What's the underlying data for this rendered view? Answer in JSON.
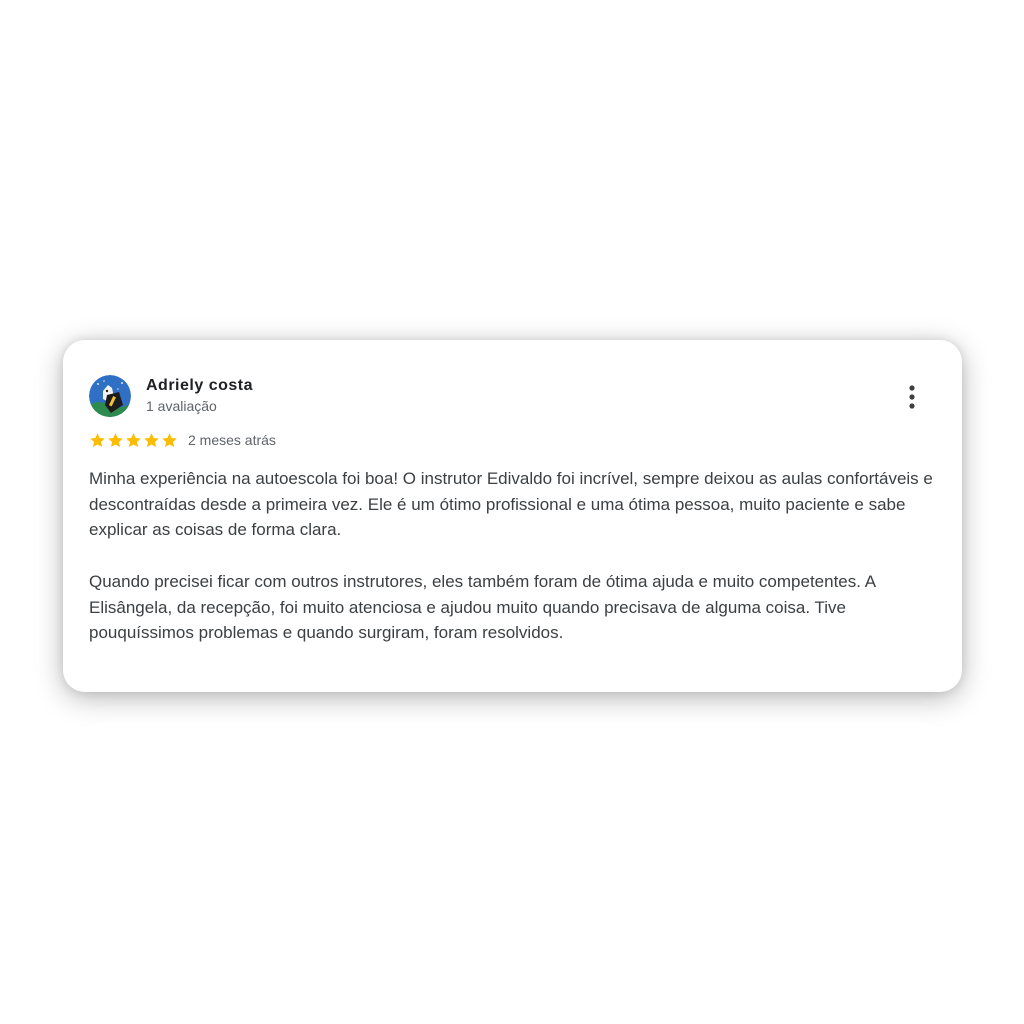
{
  "review": {
    "author_name": "Adriely costa",
    "author_review_count": "1 avaliação",
    "rating": 5,
    "rating_max": 5,
    "date": "2 meses atrás",
    "paragraphs": [
      "Minha experiência na autoescola foi boa! O instrutor Edivaldo foi incrível, sempre deixou as aulas confortáveis e descontraídas desde a primeira vez. Ele é um ótimo profissional e uma ótima pessoa, muito paciente e sabe explicar as coisas de forma clara.",
      "Quando precisei ficar com outros instrutores, eles também foram de ótima ajuda e muito competentes. A Elisângela, da recepção, foi muito atenciosa e ajudou muito quando precisava de alguma coisa. Tive pouquíssimos problemas e quando surgiram, foram resolvidos."
    ]
  },
  "icons": {
    "avatar": "avatar-image",
    "menu": "more-vert-icon",
    "star": "star-icon"
  },
  "colors": {
    "star": "#fbbc04",
    "name": "#202124",
    "secondary_text": "#5f6368",
    "body_text": "#3c4043"
  }
}
